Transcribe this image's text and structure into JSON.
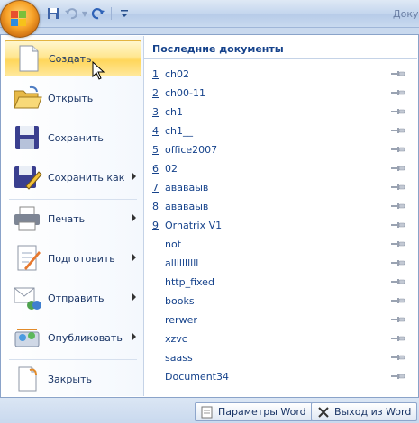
{
  "title_bar": {
    "document_title": "Доку",
    "quick_access": [
      {
        "icon": "save-icon"
      },
      {
        "icon": "undo-icon"
      },
      {
        "icon": "redo-icon"
      },
      {
        "icon": "customize-qat-icon"
      }
    ]
  },
  "menu": {
    "items": [
      {
        "label": "Создать",
        "icon": "new-document-icon"
      },
      {
        "label": "Открыть",
        "icon": "open-folder-icon"
      },
      {
        "label": "Сохранить",
        "icon": "save-disk-icon"
      },
      {
        "label": "Сохранить как",
        "icon": "save-as-icon"
      },
      {
        "label": "Печать",
        "icon": "printer-icon"
      },
      {
        "label": "Подготовить",
        "icon": "prepare-icon"
      },
      {
        "label": "Отправить",
        "icon": "send-icon"
      },
      {
        "label": "Опубликовать",
        "icon": "publish-icon"
      },
      {
        "label": "Закрыть",
        "icon": "close-document-icon"
      }
    ]
  },
  "recent": {
    "title": "Последние документы",
    "documents": [
      {
        "num": "1",
        "name": "ch02"
      },
      {
        "num": "2",
        "name": "ch00-11"
      },
      {
        "num": "3",
        "name": "ch1"
      },
      {
        "num": "4",
        "name": "ch1__"
      },
      {
        "num": "5",
        "name": "office2007"
      },
      {
        "num": "6",
        "name": "02"
      },
      {
        "num": "7",
        "name": "ававаыв"
      },
      {
        "num": "8",
        "name": "ававаыв"
      },
      {
        "num": "9",
        "name": "Ornatrix V1"
      },
      {
        "num": "",
        "name": "not"
      },
      {
        "num": "",
        "name": "allllllllll"
      },
      {
        "num": "",
        "name": "http_fixed"
      },
      {
        "num": "",
        "name": "books"
      },
      {
        "num": "",
        "name": "rerwer"
      },
      {
        "num": "",
        "name": "xzvc"
      },
      {
        "num": "",
        "name": "saass"
      },
      {
        "num": "",
        "name": "Document34"
      }
    ]
  },
  "bottom": {
    "options_label": "Параметры Word",
    "exit_label": "Выход из Word"
  },
  "colors": {
    "accent": "#15428b",
    "highlight": "#ffd65b",
    "office_button": "#f8a42a"
  }
}
